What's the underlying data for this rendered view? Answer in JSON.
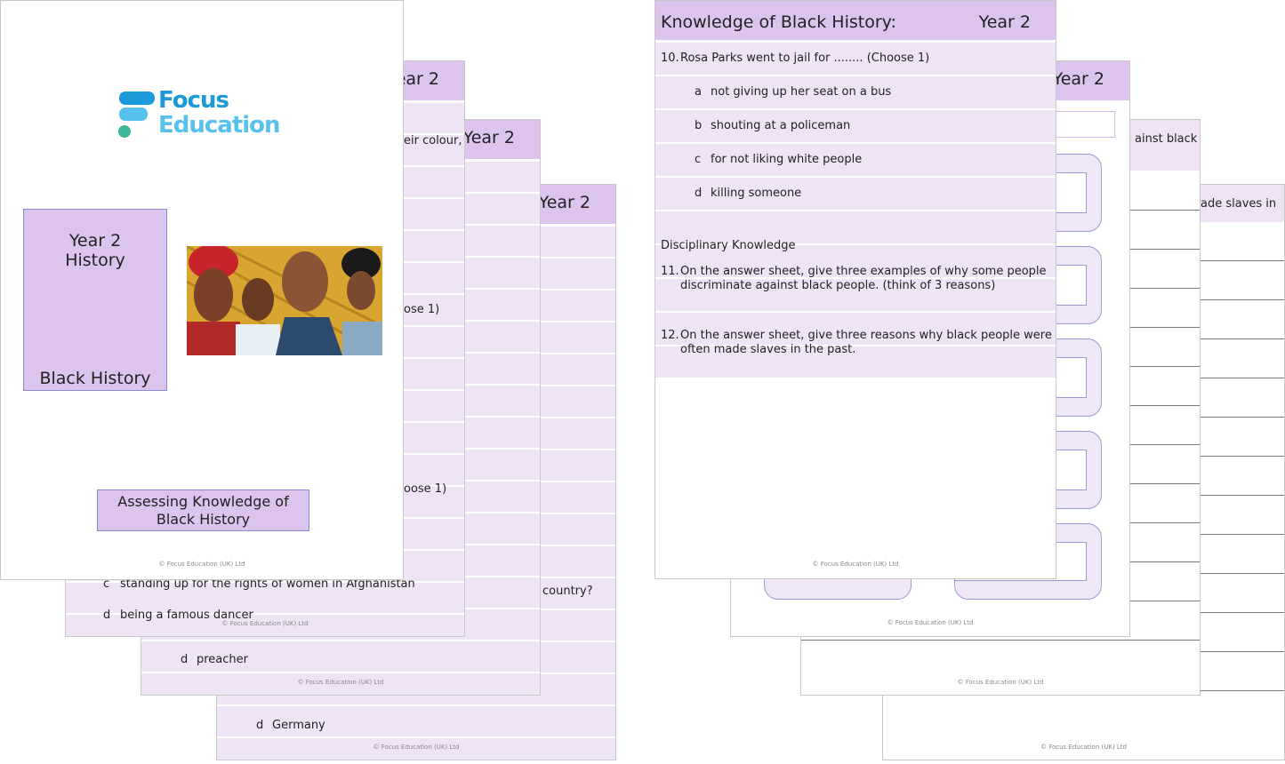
{
  "left_stack": {
    "page4": {
      "year": "Year 2",
      "fragment": "country?",
      "option": "d",
      "option_text": "Germany",
      "footer": "© Focus Education (UK) Ltd"
    },
    "page3": {
      "year": "Year 2",
      "option": "d",
      "option_text": "preacher",
      "footer": "© Focus Education (UK) Ltd"
    },
    "page2": {
      "year": "ear 2",
      "fragments": [
        "eir colour,",
        "ose 1)",
        "oose 1)"
      ],
      "option_c": "c",
      "option_c_text": "standing up for the rights of women in Afghanistan",
      "option_d": "d",
      "option_d_text": "being a famous dancer",
      "footer": "© Focus Education (UK) Ltd"
    },
    "cover": {
      "logo_line1": "Focus",
      "logo_line2": "Education",
      "box_line1": "Year 2",
      "box_line2": "History",
      "box_bottom": "Black History",
      "subtitle_line1": "Assessing Knowledge of",
      "subtitle_line2": "Black History",
      "footer": "© Focus Education (UK) Ltd",
      "logo_colors": [
        "#1a9ad9",
        "#56c1ec",
        "#3bb89a"
      ]
    }
  },
  "right_stack": {
    "page4": {
      "fragment": "ade slaves in",
      "footer": "© Focus Education (UK) Ltd"
    },
    "page3": {
      "fragment": "ainst black",
      "footer": "© Focus Education (UK) Ltd"
    },
    "page2": {
      "year": "Year 2",
      "footer": "© Focus Education (UK) Ltd"
    },
    "page1": {
      "title": "Knowledge of Black History:",
      "year": "Year 2",
      "q10": {
        "num": "10.",
        "text": "Rosa Parks went to jail for ........ (Choose 1)",
        "options": [
          {
            "letter": "a",
            "text": "not giving up her seat on a bus"
          },
          {
            "letter": "b",
            "text": "shouting at a policeman"
          },
          {
            "letter": "c",
            "text": "for not liking white people"
          },
          {
            "letter": "d",
            "text": "killing someone"
          }
        ]
      },
      "section": "Disciplinary Knowledge",
      "q11": {
        "num": "11.",
        "line1": "On the answer sheet, give three examples of why some people",
        "line2": "discriminate against black people. (think of 3 reasons)"
      },
      "q12": {
        "num": "12.",
        "line1": "On the answer sheet, give three reasons why black people were",
        "line2": "often made slaves in the past."
      },
      "footer": "© Focus Education (UK) Ltd"
    }
  },
  "colors": {
    "header": "#dcc4ec",
    "row": "#efe4f6",
    "box_border": "#9b9bd6"
  }
}
